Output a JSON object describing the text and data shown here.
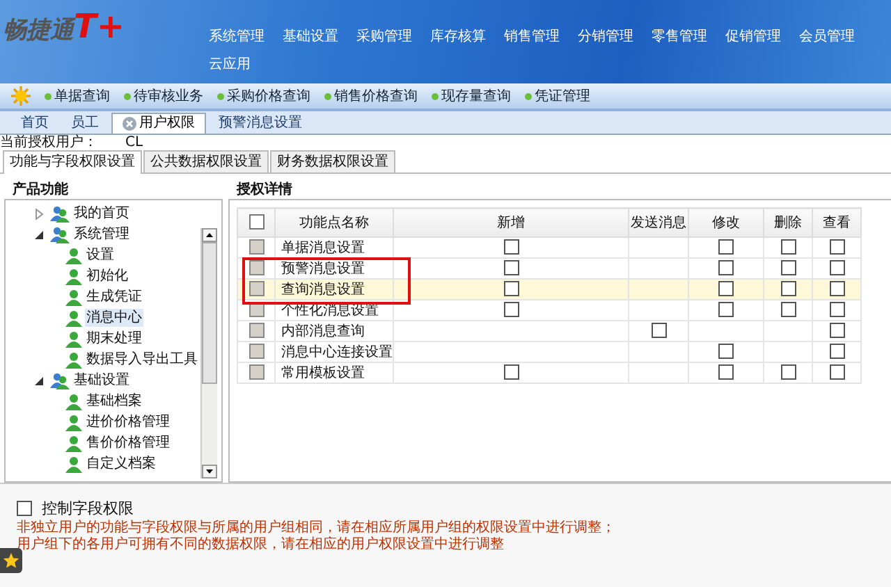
{
  "logo": {
    "text": "畅捷通",
    "mark": "T+"
  },
  "nav": [
    "系统管理",
    "基础设置",
    "采购管理",
    "库存核算",
    "销售管理",
    "分销管理",
    "零售管理",
    "促销管理",
    "会员管理",
    "云应用"
  ],
  "quick_links": [
    "单据查询",
    "待审核业务",
    "采购价格查询",
    "销售价格查询",
    "现存量查询",
    "凭证管理"
  ],
  "tabs": [
    {
      "label": "首页",
      "selected": false,
      "closable": false
    },
    {
      "label": "员工",
      "selected": false,
      "closable": false
    },
    {
      "label": "用户权限",
      "selected": true,
      "closable": true
    },
    {
      "label": "预警消息设置",
      "selected": false,
      "closable": false
    }
  ],
  "current_user": {
    "label": "当前授权用户：",
    "value": "CL"
  },
  "sub_tabs": [
    {
      "label": "功能与字段权限设置",
      "selected": true
    },
    {
      "label": "公共数据权限设置",
      "selected": false
    },
    {
      "label": "财务数据权限设置",
      "selected": false
    }
  ],
  "tree": {
    "title": "产品功能",
    "items": [
      {
        "label": "我的首页",
        "kind": "group",
        "expanded": false,
        "selected": false
      },
      {
        "label": "系统管理",
        "kind": "group",
        "expanded": true,
        "selected": false,
        "children": [
          {
            "label": "设置",
            "kind": "item",
            "selected": false
          },
          {
            "label": "初始化",
            "kind": "item",
            "selected": false
          },
          {
            "label": "生成凭证",
            "kind": "item",
            "selected": false
          },
          {
            "label": "消息中心",
            "kind": "item",
            "selected": true
          },
          {
            "label": "期末处理",
            "kind": "item",
            "selected": false
          },
          {
            "label": "数据导入导出工具",
            "kind": "item",
            "selected": false
          }
        ]
      },
      {
        "label": "基础设置",
        "kind": "group",
        "expanded": true,
        "selected": false,
        "children": [
          {
            "label": "基础档案",
            "kind": "item",
            "selected": false
          },
          {
            "label": "进价价格管理",
            "kind": "item",
            "selected": false
          },
          {
            "label": "售价价格管理",
            "kind": "item",
            "selected": false
          },
          {
            "label": "自定义档案",
            "kind": "item",
            "selected": false
          }
        ]
      }
    ]
  },
  "details": {
    "title": "授权详情",
    "all_checked": false,
    "columns": [
      "功能点名称",
      "新增",
      "发送消息",
      "修改",
      "删除",
      "查看"
    ],
    "rows": [
      {
        "name": "单据消息设置",
        "checked": false,
        "selected": false,
        "cells": [
          {
            "checked": false
          },
          null,
          {
            "checked": false
          },
          {
            "checked": false
          },
          {
            "checked": false
          }
        ]
      },
      {
        "name": "预警消息设置",
        "checked": false,
        "selected": false,
        "cells": [
          {
            "checked": false
          },
          null,
          {
            "checked": false
          },
          {
            "checked": false
          },
          {
            "checked": false
          }
        ]
      },
      {
        "name": "查询消息设置",
        "checked": false,
        "selected": true,
        "cells": [
          {
            "checked": false
          },
          null,
          {
            "checked": false
          },
          {
            "checked": false
          },
          {
            "checked": false
          }
        ]
      },
      {
        "name": "个性化消息设置",
        "checked": false,
        "selected": false,
        "cells": [
          {
            "checked": false
          },
          null,
          {
            "checked": false
          },
          {
            "checked": false
          },
          {
            "checked": false
          }
        ]
      },
      {
        "name": "内部消息查询",
        "checked": false,
        "selected": false,
        "cells": [
          null,
          {
            "checked": false
          },
          null,
          null,
          {
            "checked": false
          }
        ]
      },
      {
        "name": "消息中心连接设置",
        "checked": false,
        "selected": false,
        "cells": [
          null,
          null,
          {
            "checked": false
          },
          null,
          {
            "checked": false
          }
        ]
      },
      {
        "name": "常用模板设置",
        "checked": false,
        "selected": false,
        "cells": [
          {
            "checked": false
          },
          null,
          {
            "checked": false
          },
          {
            "checked": false
          },
          {
            "checked": false
          }
        ]
      }
    ]
  },
  "field_control": {
    "label": "控制字段权限",
    "checked": false
  },
  "notes": [
    "非独立用户的功能与字段权限与所属的用户组相同，请在相应所属用户组的权限设置中进行调整；",
    "用户组下的各用户可拥有不同的数据权限，请在相应的用户权限设置中进行调整"
  ]
}
